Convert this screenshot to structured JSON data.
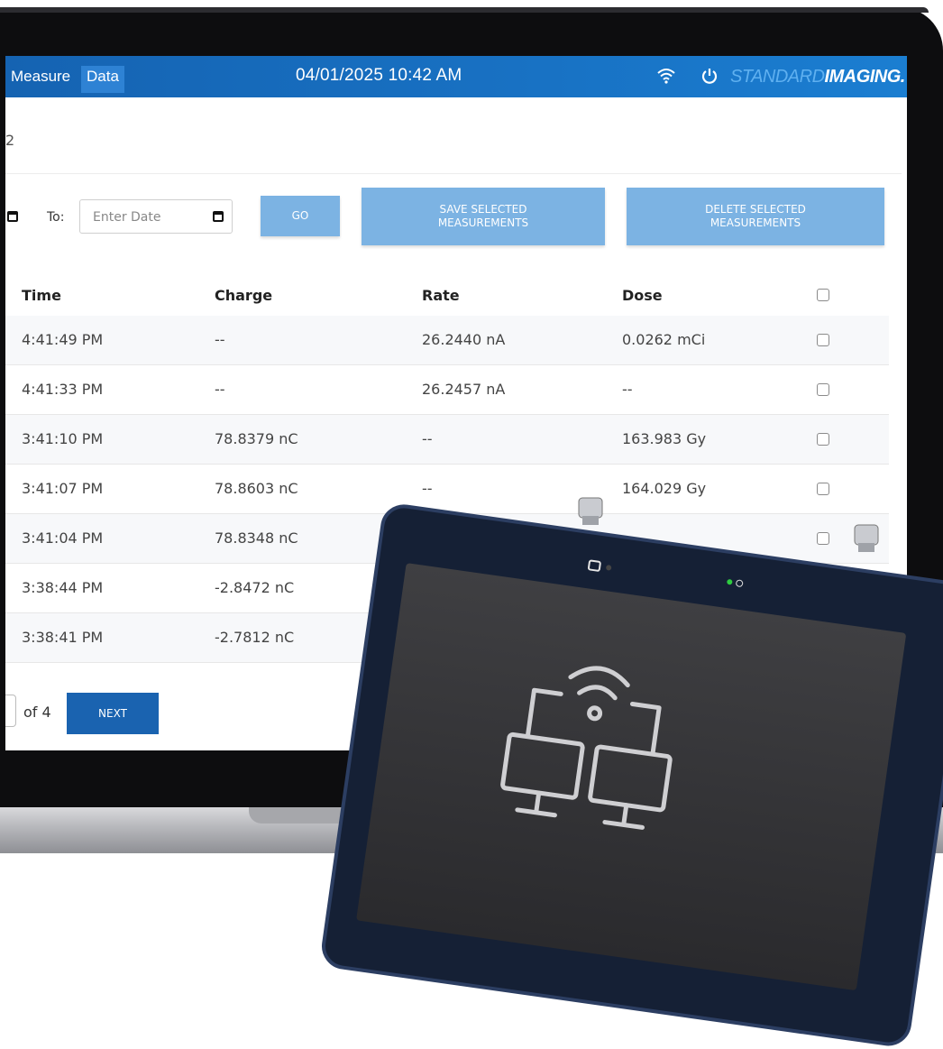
{
  "nav": {
    "tabs": [
      {
        "label": "Measure"
      },
      {
        "label": "Data"
      }
    ],
    "datetime": "04/01/2025 10:42 AM",
    "brand_light": "STANDARD",
    "brand_bold": "IMAGING."
  },
  "page": {
    "subtitle": "2"
  },
  "filters": {
    "to_label": "To:",
    "date_placeholder": "Enter Date",
    "go_label": "GO",
    "save_label_1": "SAVE SELECTED",
    "save_label_2": "MEASUREMENTS",
    "delete_label_1": "DELETE SELECTED",
    "delete_label_2": "MEASUREMENTS"
  },
  "table": {
    "columns": [
      "Time",
      "Charge",
      "Rate",
      "Dose"
    ],
    "rows": [
      {
        "time": "4:41:49 PM",
        "charge": "--",
        "rate": "26.2440  nA",
        "dose": "0.0262  mCi"
      },
      {
        "time": "4:41:33 PM",
        "charge": "--",
        "rate": "26.2457  nA",
        "dose": "--"
      },
      {
        "time": "3:41:10 PM",
        "charge": "78.8379  nC",
        "rate": "--",
        "dose": "163.983  Gy"
      },
      {
        "time": "3:41:07 PM",
        "charge": "78.8603  nC",
        "rate": "--",
        "dose": "164.029  Gy"
      },
      {
        "time": "3:41:04 PM",
        "charge": "78.8348  nC",
        "rate": "",
        "dose": ""
      },
      {
        "time": "3:38:44 PM",
        "charge": "-2.8472  nC",
        "rate": "",
        "dose": ""
      },
      {
        "time": "3:38:41 PM",
        "charge": "-2.7812  nC",
        "rate": "",
        "dose": ""
      }
    ]
  },
  "pagination": {
    "of_label": "of 4",
    "next_label": "NEXT"
  },
  "colors": {
    "topbar": "#1872c4",
    "button": "#7cb3e3",
    "next": "#1a63b0",
    "tablet_frame": "#2c3e62"
  }
}
